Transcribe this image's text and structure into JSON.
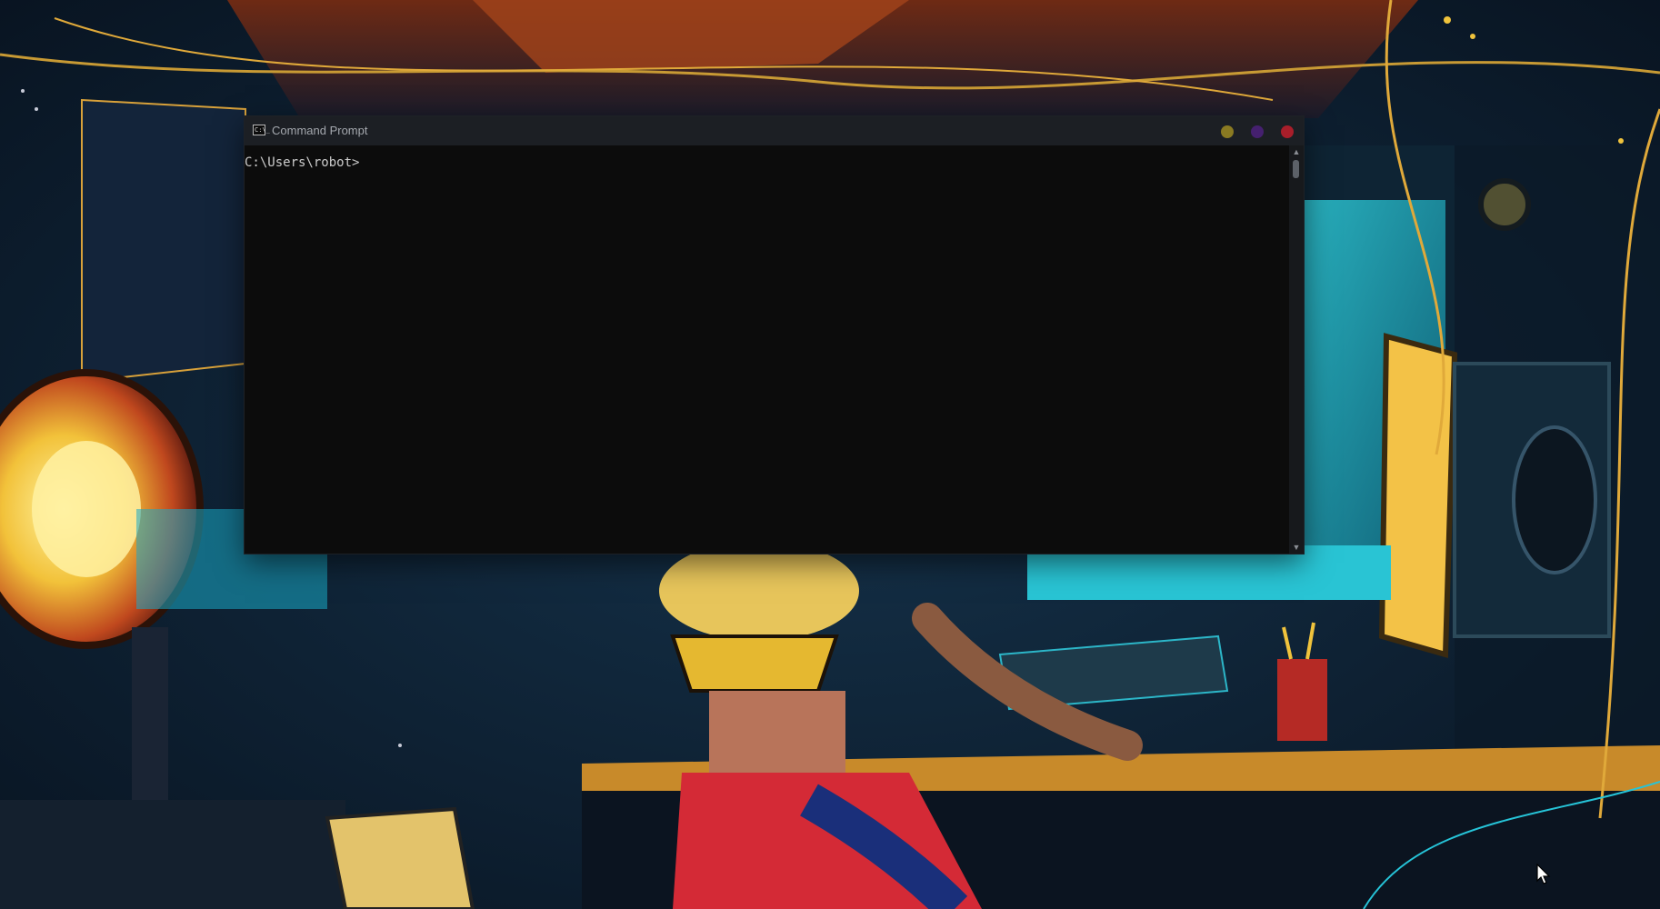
{
  "window": {
    "title": "Command Prompt",
    "icon": "cmd-icon",
    "icon_text": "C:\\_",
    "buttons": {
      "minimize": {
        "icon": "minimize-dot-icon",
        "color": "#8a7a22"
      },
      "maximize": {
        "icon": "maximize-dot-icon",
        "color": "#45206f"
      },
      "close": {
        "icon": "close-dot-icon",
        "color": "#a81e2a"
      }
    }
  },
  "console": {
    "prompt": "C:\\Users\\robot>",
    "background": "#0c0c0c",
    "text_color": "#cccccc"
  },
  "scrollbar": {
    "up_glyph": "▲",
    "down_glyph": "▼"
  },
  "desktop": {
    "wallpaper": "cyberpunk-workstation-illustration",
    "accent_colors": [
      "#17b8c9",
      "#f0c33c",
      "#d8332f",
      "#1a2a4a"
    ]
  }
}
